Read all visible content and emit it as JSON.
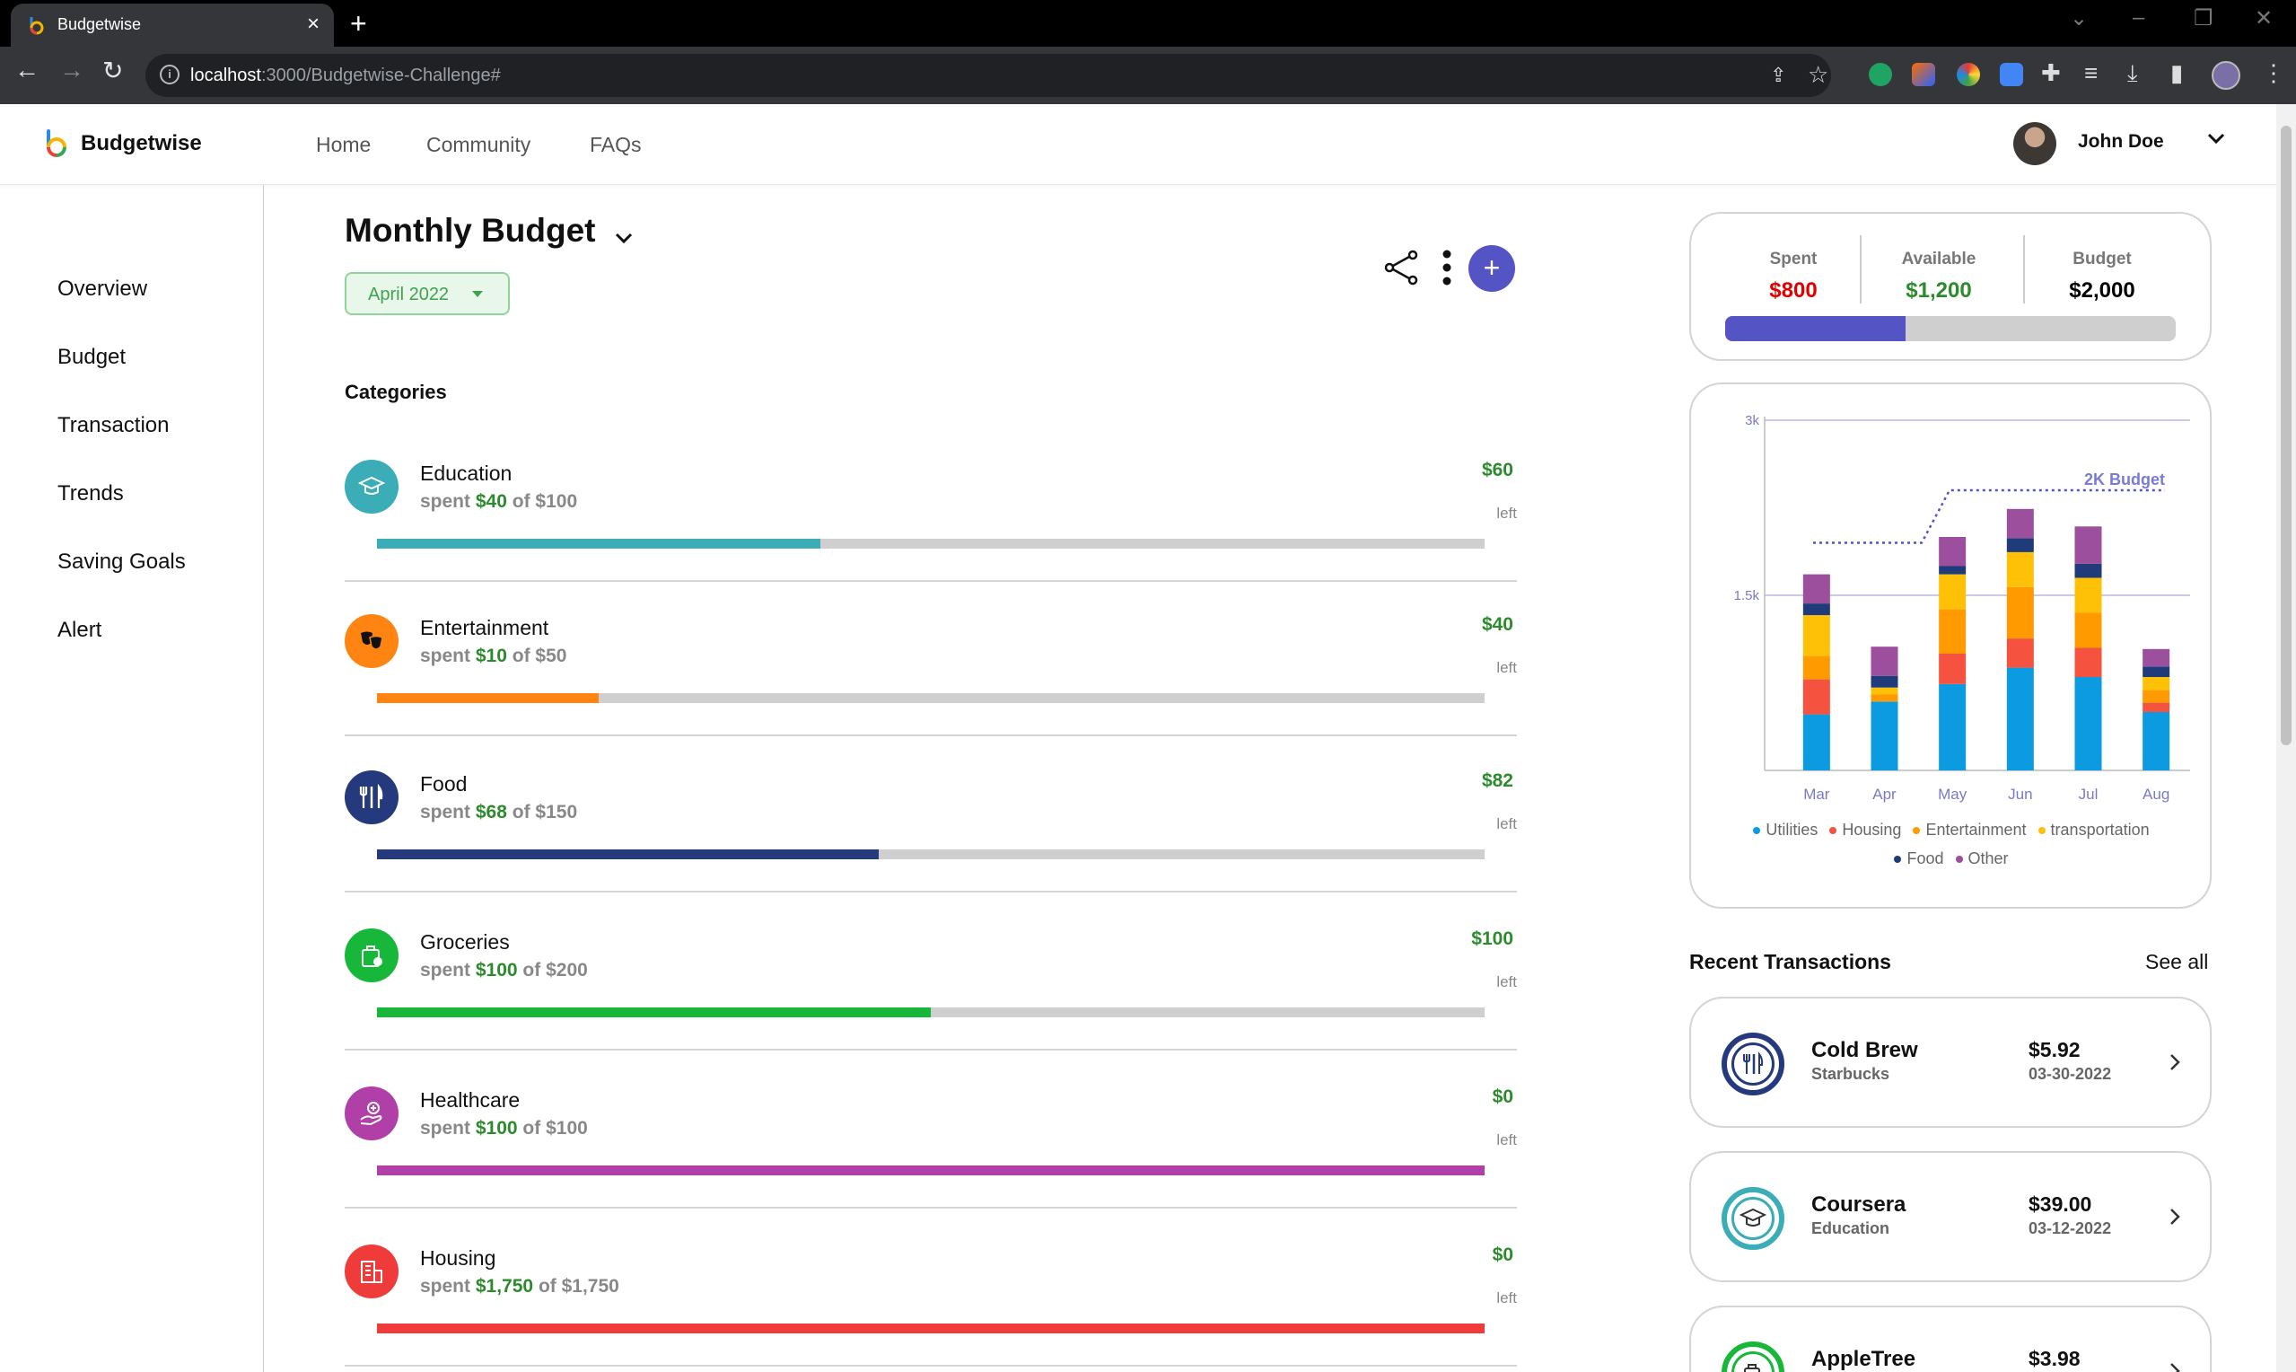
{
  "browser": {
    "tab_title": "Budgetwise",
    "url_host": "localhost",
    "url_path": ":3000/Budgetwise-Challenge#"
  },
  "nav": {
    "brand": "Budgetwise",
    "links": [
      "Home",
      "Community",
      "FAQs"
    ],
    "user_name": "John Doe"
  },
  "sidebar": {
    "items": [
      "Overview",
      "Budget",
      "Transaction",
      "Trends",
      "Saving Goals",
      "Alert"
    ]
  },
  "main": {
    "title": "Monthly Budget",
    "month": "April 2022",
    "categories_heading": "Categories",
    "add_label": "+",
    "categories": [
      {
        "name": "Education",
        "spent_word": "spent",
        "spent": "$40",
        "of_word": "of",
        "budget": "$100",
        "left": "$60",
        "left_label": "left",
        "fill": 0.4,
        "color": "#3aadb6"
      },
      {
        "name": "Entertainment",
        "spent_word": "spent",
        "spent": "$10",
        "of_word": "of",
        "budget": "$50",
        "left": "$40",
        "left_label": "left",
        "fill": 0.2,
        "color": "#ff8412"
      },
      {
        "name": "Food",
        "spent_word": "spent",
        "spent": "$68",
        "of_word": "of",
        "budget": "$150",
        "left": "$82",
        "left_label": "left",
        "fill": 0.4533,
        "color": "#243a7c"
      },
      {
        "name": "Groceries",
        "spent_word": "spent",
        "spent": "$100",
        "of_word": "of",
        "budget": "$200",
        "left": "$100",
        "left_label": "left",
        "fill": 0.5,
        "color": "#17b83a"
      },
      {
        "name": "Healthcare",
        "spent_word": "spent",
        "spent": "$100",
        "of_word": "of",
        "budget": "$100",
        "left": "$0",
        "left_label": "left",
        "fill": 1.0,
        "color": "#b040a8"
      },
      {
        "name": "Housing",
        "spent_word": "spent",
        "spent": "$1,750",
        "of_word": "of",
        "budget": "$1,750",
        "left": "$0",
        "left_label": "left",
        "fill": 1.0,
        "color": "#f03b3b"
      }
    ]
  },
  "summary": {
    "spent_label": "Spent",
    "spent_value": "$800",
    "spent_color": "#e00000",
    "available_label": "Available",
    "available_value": "$1,200",
    "available_color": "#2d8a2d",
    "budget_label": "Budget",
    "budget_value": "$2,000",
    "progress": 0.4,
    "progress_color": "#5454c4"
  },
  "chart_data": {
    "type": "bar",
    "stacked": true,
    "categories": [
      "Mar",
      "Apr",
      "May",
      "Jun",
      "Jul",
      "Aug"
    ],
    "y_ticks": [
      "1.5k",
      "3k"
    ],
    "ylim": [
      0,
      3000
    ],
    "series": [
      {
        "name": "Utilities",
        "color": "#0c9ae0",
        "values": [
          480,
          590,
          740,
          880,
          800,
          500
        ]
      },
      {
        "name": "Housing",
        "color": "#f5523f",
        "values": [
          300,
          0,
          260,
          250,
          250,
          80
        ]
      },
      {
        "name": "Entertainment",
        "color": "#ff9a00",
        "values": [
          200,
          60,
          380,
          440,
          300,
          110
        ]
      },
      {
        "name": "transportation",
        "color": "#ffc107",
        "values": [
          350,
          60,
          300,
          300,
          300,
          110
        ]
      },
      {
        "name": "Food",
        "color": "#1f3b7a",
        "values": [
          100,
          100,
          70,
          120,
          120,
          90
        ]
      },
      {
        "name": "Other",
        "color": "#9c4f9c",
        "values": [
          250,
          250,
          250,
          250,
          320,
          150
        ]
      }
    ],
    "budget_line": {
      "label": "2K Budget",
      "start": 1950,
      "end": 2400
    }
  },
  "recent": {
    "title": "Recent Transactions",
    "see_all": "See all",
    "items": [
      {
        "name": "Cold Brew",
        "category": "Starbucks",
        "amount": "$5.92",
        "date": "03-30-2022",
        "color": "#243a7c"
      },
      {
        "name": "Coursera",
        "category": "Education",
        "amount": "$39.00",
        "date": "03-12-2022",
        "color": "#3aadb6"
      },
      {
        "name": "AppleTree",
        "category": "",
        "amount": "$3.98",
        "date": "",
        "color": "#17b83a"
      }
    ]
  }
}
